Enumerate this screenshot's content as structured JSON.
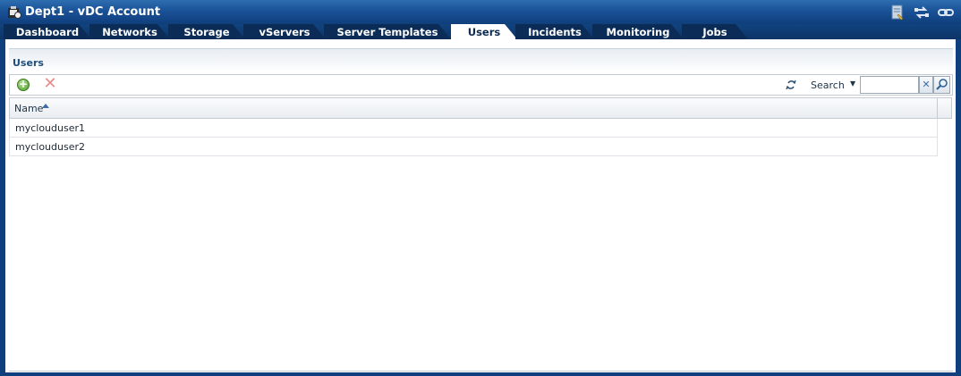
{
  "window": {
    "title": "Dept1 - vDC Account",
    "icons": [
      "account-icon",
      "notes-icon",
      "switch-icon",
      "link-icon"
    ]
  },
  "tabs": [
    {
      "label": "Dashboard",
      "active": false
    },
    {
      "label": "Networks",
      "active": false
    },
    {
      "label": "Storage",
      "active": false
    },
    {
      "label": "vServers",
      "active": false
    },
    {
      "label": "Server Templates",
      "active": false
    },
    {
      "label": "Users",
      "active": true
    },
    {
      "label": "Incidents",
      "active": false
    },
    {
      "label": "Monitoring",
      "active": false
    },
    {
      "label": "Jobs",
      "active": false
    }
  ],
  "panel": {
    "title": "Users"
  },
  "toolbar": {
    "add_icon": "add-icon",
    "delete_icon": "delete-icon",
    "refresh_icon": "refresh-icon",
    "search_label": "Search",
    "search_value": "",
    "search_placeholder": ""
  },
  "table": {
    "columns": [
      {
        "label": "Name",
        "sort": "ascending"
      }
    ],
    "rows": [
      {
        "name": "myclouduser1"
      },
      {
        "name": "myclouduser2"
      }
    ]
  },
  "colors": {
    "header_bg": "#1a5196",
    "tab_bg": "#0a2c57",
    "active_tab_bg": "#ffffff",
    "panel_title": "#1e4e7a"
  }
}
